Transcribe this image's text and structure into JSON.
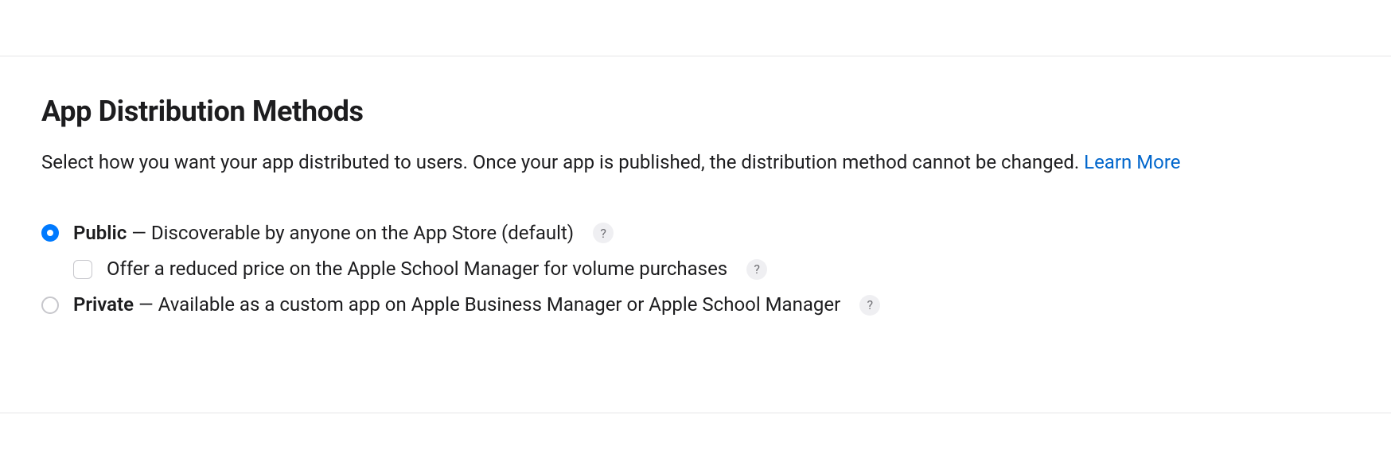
{
  "heading": "App Distribution Methods",
  "description": "Select how you want your app distributed to users. Once your app is published, the distribution method cannot be changed. ",
  "learn_more": "Learn More",
  "options": {
    "public": {
      "label": "Public",
      "desc": " — Discoverable by anyone on the App Store (default)",
      "selected": true,
      "sub": {
        "label": "Offer a reduced price on the Apple School Manager for volume purchases",
        "checked": false
      }
    },
    "private": {
      "label": "Private",
      "desc": " — Available as a custom app on Apple Business Manager or Apple School Manager",
      "selected": false
    }
  },
  "help_glyph": "?"
}
